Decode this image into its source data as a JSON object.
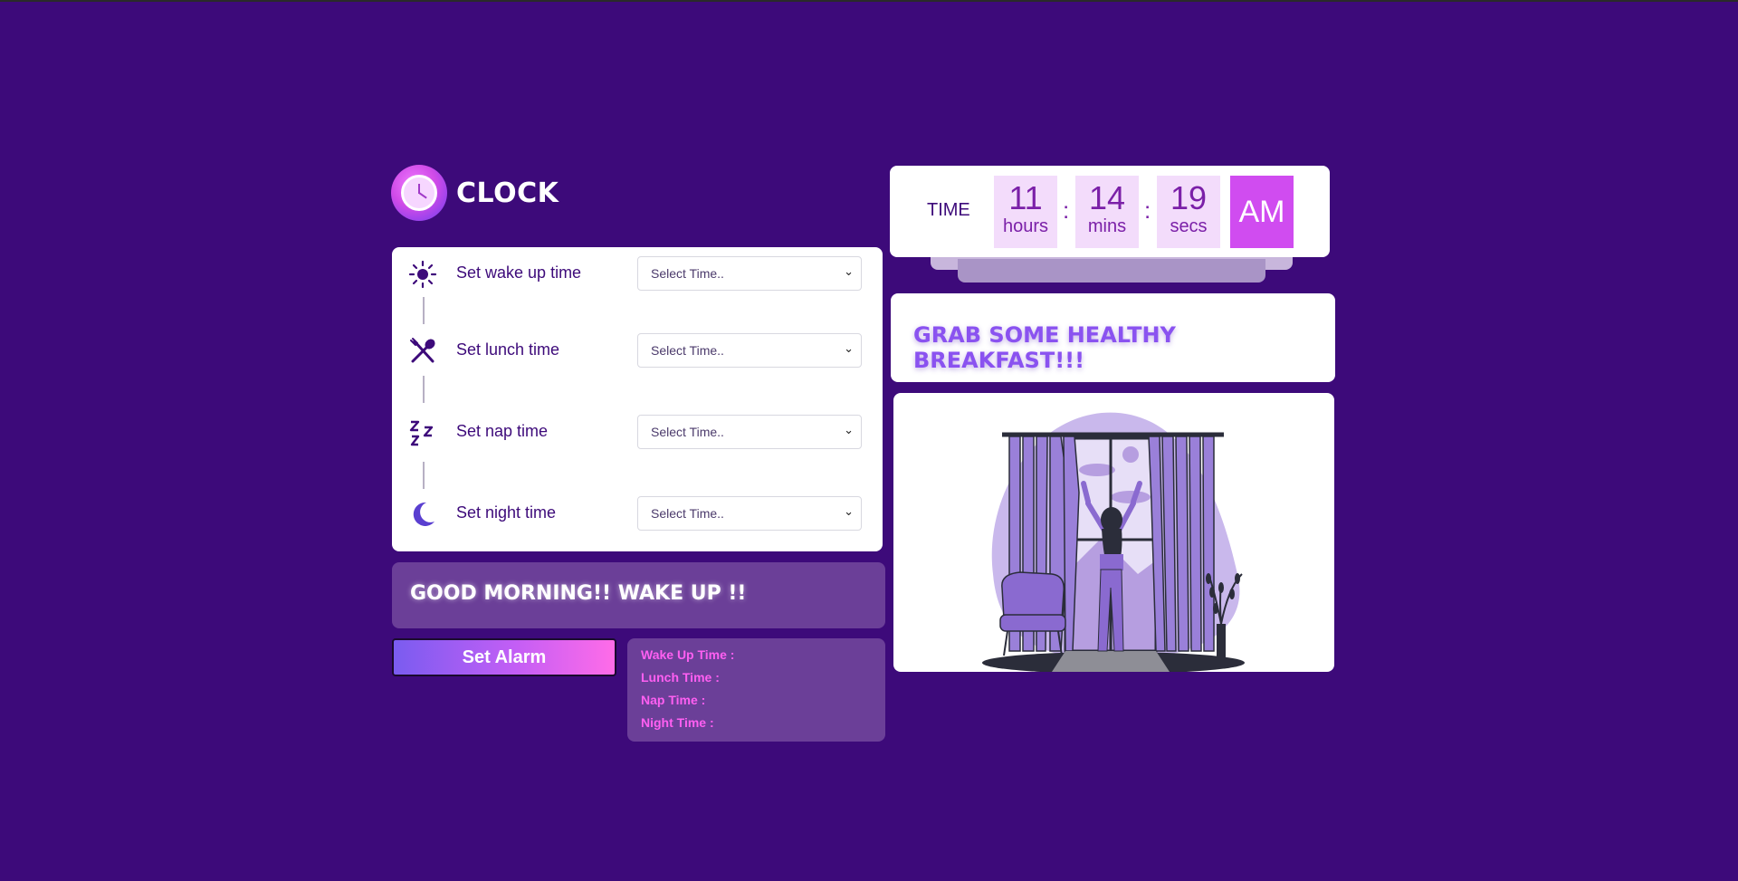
{
  "app": {
    "logo_text": "CLOCK"
  },
  "settings": {
    "rows": [
      {
        "icon": "sun-icon",
        "label": "Set wake up time",
        "select_value": "Select Time.."
      },
      {
        "icon": "utensils-icon",
        "label": "Set lunch time",
        "select_value": "Select Time.."
      },
      {
        "icon": "sleep-zzz-icon",
        "label": "Set nap time",
        "select_value": "Select Time.."
      },
      {
        "icon": "moon-icon",
        "label": "Set night time",
        "select_value": "Select Time.."
      }
    ]
  },
  "message": {
    "text": "GOOD MORNING!! WAKE UP !!"
  },
  "set_alarm": {
    "label": "Set Alarm"
  },
  "summary": {
    "lines": [
      "Wake Up Time :",
      "Lunch Time :",
      "Nap Time :",
      "Night Time :"
    ]
  },
  "clock": {
    "label": "TIME",
    "hours": "11",
    "hours_unit": "hours",
    "mins": "14",
    "mins_unit": "mins",
    "secs": "19",
    "secs_unit": "secs",
    "separator": ":",
    "ampm": "AM"
  },
  "greeting": {
    "text": "GRAB SOME HEALTHY BREAKFAST!!!"
  },
  "colors": {
    "background": "#3d0a7a",
    "accent": "#d04cf0",
    "panel": "#6b3f98",
    "highlight": "#ff5ff2"
  }
}
